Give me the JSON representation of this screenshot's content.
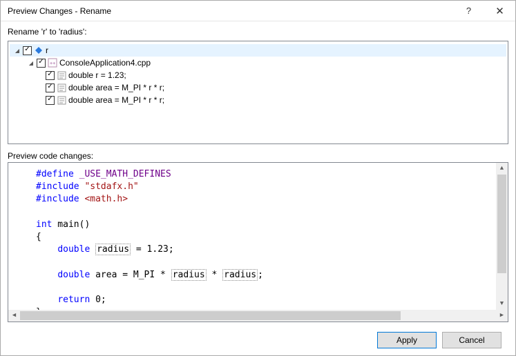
{
  "window": {
    "title": "Preview Changes - Rename",
    "help": "?",
    "close": "✕"
  },
  "section1": {
    "label": "Rename 'r' to 'radius':"
  },
  "tree": {
    "root": {
      "label": "r"
    },
    "file": {
      "label": "ConsoleApplication4.cpp"
    },
    "items": [
      {
        "label": "double r = 1.23;"
      },
      {
        "label": "double area = M_PI * r * r;"
      },
      {
        "label": "double area = M_PI * r * r;"
      }
    ]
  },
  "section2": {
    "label": "Preview code changes:"
  },
  "code": {
    "l1a": "#define",
    "l1b": " _USE_MATH_DEFINES",
    "l2a": "#include",
    "l2b": " \"stdafx.h\"",
    "l3a": "#include",
    "l3b": " <math.h>",
    "l5a": "int",
    "l5b": " main()",
    "l6": "{",
    "l7a": "    ",
    "l7b": "double",
    "l7c": " ",
    "l7d": "radius",
    "l7e": " = 1.23;",
    "l9a": "    ",
    "l9b": "double",
    "l9c": " area = M_PI * ",
    "l9d": "radius",
    "l9e": " * ",
    "l9f": "radius",
    "l9g": ";",
    "l11a": "    ",
    "l11b": "return",
    "l11c": " 0;",
    "l12": "}"
  },
  "buttons": {
    "apply": "Apply",
    "cancel": "Cancel"
  }
}
